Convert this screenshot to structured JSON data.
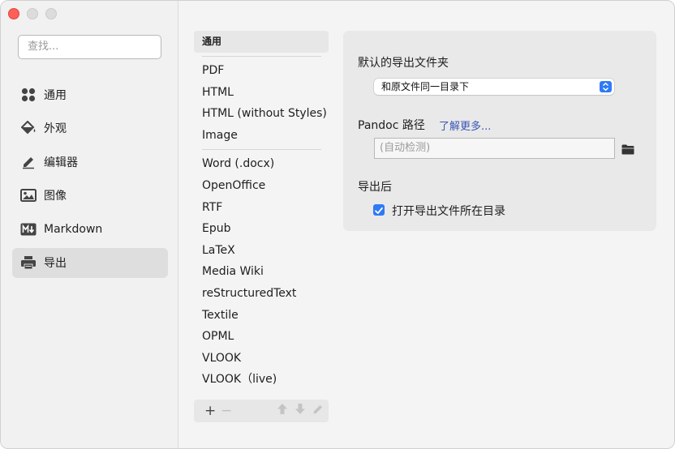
{
  "search": {
    "placeholder": "查找..."
  },
  "nav": [
    {
      "label": "通用",
      "icon": "grid-icon"
    },
    {
      "label": "外观",
      "icon": "paint-bucket-icon"
    },
    {
      "label": "编辑器",
      "icon": "pencil-icon"
    },
    {
      "label": "图像",
      "icon": "image-icon"
    },
    {
      "label": "Markdown",
      "icon": "markdown-icon"
    },
    {
      "label": "导出",
      "icon": "printer-icon",
      "active": true
    }
  ],
  "export_list": {
    "header": "通用",
    "group1": [
      "PDF",
      "HTML",
      "HTML (without Styles)",
      "Image"
    ],
    "group2": [
      "Word (.docx)",
      "OpenOffice",
      "RTF",
      "Epub",
      "LaTeX",
      "Media Wiki",
      "reStructuredText",
      "Textile",
      "OPML",
      "VLOOK",
      "VLOOK（live)"
    ],
    "toolbar": {
      "add": "+",
      "remove": "−"
    }
  },
  "settings": {
    "default_folder_title": "默认的导出文件夹",
    "default_folder_value": "和原文件同一目录下",
    "pandoc_title": "Pandoc 路径",
    "pandoc_link": "了解更多...",
    "pandoc_placeholder": "(自动检测)",
    "after_export_title": "导出后",
    "open_folder_label": "打开导出文件所在目录",
    "open_folder_checked": true
  },
  "colors": {
    "accent": "#2f7af5",
    "link": "#3a55b5",
    "close": "#fe5f57"
  }
}
